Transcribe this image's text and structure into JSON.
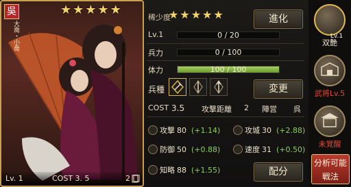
{
  "card": {
    "stars": [
      "★",
      "★",
      "★",
      "★",
      "★"
    ],
    "faction_char": "吳",
    "faction_sub": "大喬・小喬",
    "level": "Lv. 1",
    "cost": "COST  3. 5",
    "count": "2"
  },
  "info": {
    "rarity_label": "稀少度",
    "rarity_stars": [
      "★",
      "★",
      "★",
      "★",
      "★"
    ],
    "evolve_button": "進化",
    "lv_label": "Lv.1",
    "lv_value": "0 / 20",
    "lv_progress": 0,
    "troops_label": "兵力",
    "troops_value": "0 / 100",
    "troops_progress": 0,
    "stamina_label": "体力",
    "stamina_value": "100 / 100",
    "stamina_progress": 1.0,
    "arm_label": "兵種",
    "change_button": "変更",
    "cost_label": "COST",
    "cost_value": "3.5",
    "range_label": "攻撃距離",
    "range_value": "2",
    "camp_label": "陣営",
    "camp_value": "呉",
    "assign_button": "配分"
  },
  "stats": [
    {
      "name": "攻撃",
      "value": "80",
      "bonus": "(+1.14)"
    },
    {
      "name": "攻城",
      "value": "30",
      "bonus": "(+2.88)"
    },
    {
      "name": "防御",
      "value": "50",
      "bonus": "(+0.88)"
    },
    {
      "name": "速度",
      "value": "31",
      "bonus": "(+0.50)"
    },
    {
      "name": "知略",
      "value": "88",
      "bonus": "(+1.55)"
    }
  ],
  "side": {
    "tab1_badge": "Lv.1",
    "tab1_label": "双艶",
    "tab2_label": "武将Lv.5",
    "tab3_label": "未覚醒",
    "analyze_line1": "分析可能",
    "analyze_line2": "戦法"
  }
}
